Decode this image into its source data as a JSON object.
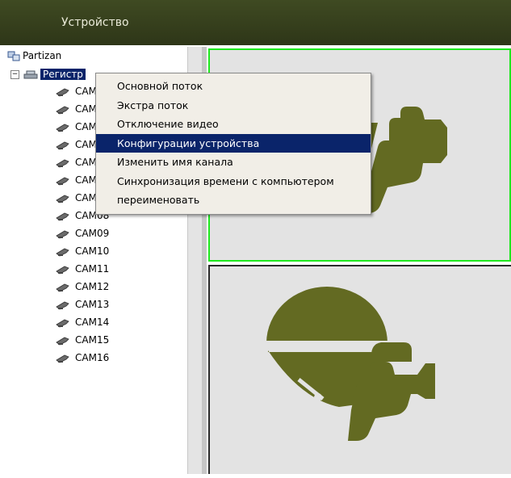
{
  "header": {
    "title": "Устройство"
  },
  "tree": {
    "root_label": "Partizan",
    "registrar_label": "Регистр",
    "cameras": [
      "CAM01",
      "CAM02",
      "CAM03",
      "CAM04",
      "CAM05",
      "CAM06",
      "CAM07",
      "CAM08",
      "CAM09",
      "CAM10",
      "CAM11",
      "CAM12",
      "CAM13",
      "CAM14",
      "CAM15",
      "CAM16"
    ]
  },
  "context_menu": {
    "items": [
      "Основной поток",
      "Экстра поток",
      "Отключение видео",
      "Конфигурации устройства",
      "Изменить имя канала",
      "Синхронизация времени с компьютером",
      "переименовать"
    ],
    "active_index": 3
  },
  "colors": {
    "header": "#3f4a22",
    "logo": "#636a22",
    "selection": "#0a246a",
    "active_border": "#1ee81e"
  }
}
